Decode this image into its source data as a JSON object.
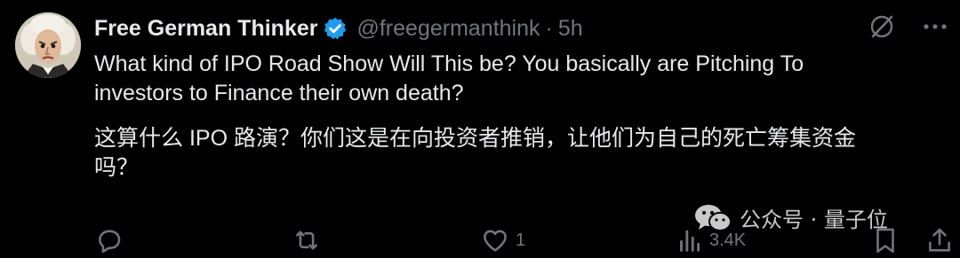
{
  "author": {
    "display_name": "Free German Thinker",
    "handle": "@freegermanthink",
    "separator": "·",
    "time": "5h",
    "verified": true
  },
  "tweet": {
    "line_en": "What kind of IPO Road Show Will This be? You basically are Pitching To\ninvestors to Finance their own death?",
    "line_zh": "这算什么 IPO 路演？你们这是在向投资者推销，让他们为自己的死亡筹集资金\n吗？"
  },
  "actions": {
    "reply_count": "",
    "repost_count": "",
    "like_count": "1",
    "views_count": "3.4K"
  },
  "watermark": {
    "text": "公众号 · 量子位"
  },
  "colors": {
    "background": "#000000",
    "text_primary": "#e7e9ea",
    "text_secondary": "#71767b",
    "verified_blue": "#1d9bf0"
  },
  "icons": [
    "verified-badge-icon",
    "grok-icon",
    "more-icon",
    "reply-icon",
    "repost-icon",
    "like-icon",
    "views-icon",
    "bookmark-icon",
    "share-icon",
    "wechat-icon"
  ]
}
